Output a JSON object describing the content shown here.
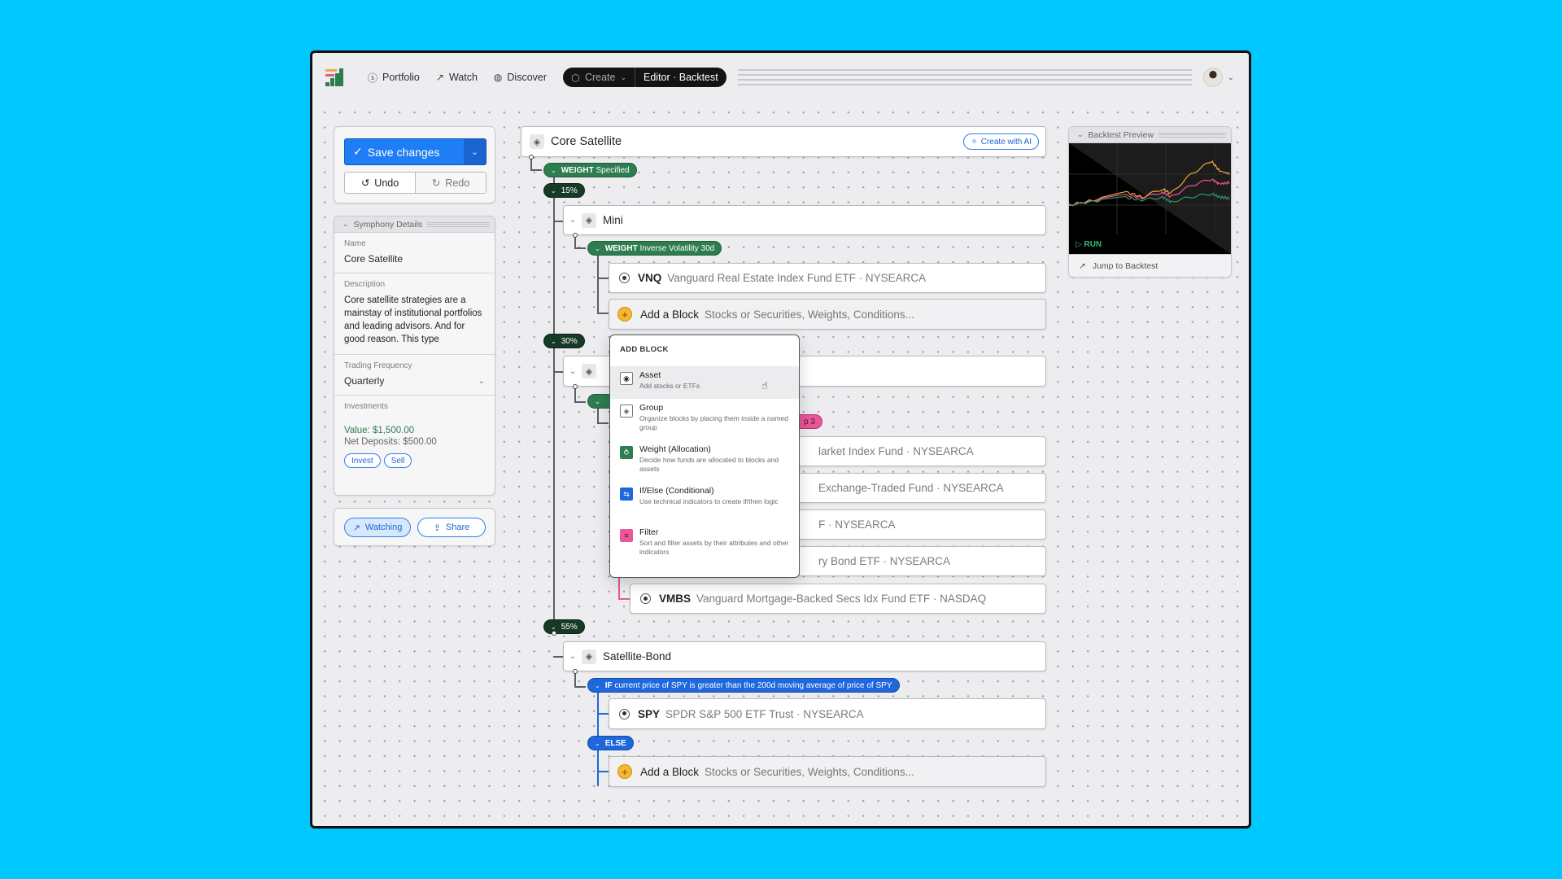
{
  "nav": {
    "logo": "composer-logo",
    "items": [
      {
        "label": "Portfolio",
        "icon": "dollar-circle-icon"
      },
      {
        "label": "Watch",
        "icon": "trend-icon"
      },
      {
        "label": "Discover",
        "icon": "globe-icon"
      }
    ],
    "create_label": "Create",
    "editor_label": "Editor · Backtest"
  },
  "toolbar": {
    "save_label": "Save changes",
    "undo_label": "Undo",
    "redo_label": "Redo"
  },
  "details": {
    "panel_title": "Symphony Details",
    "name_label": "Name",
    "name_value": "Core Satellite",
    "description_label": "Description",
    "description_value": "Core satellite strategies are a mainstay of institutional portfolios and leading advisors. And for good reason. This type",
    "frequency_label": "Trading Frequency",
    "frequency_value": "Quarterly",
    "investments_label": "Investments",
    "value_text": "Value: $1,500.00",
    "net_deposits_text": "Net Deposits: $500.00",
    "invest_label": "Invest",
    "sell_label": "Sell"
  },
  "social": {
    "watching_label": "Watching",
    "share_label": "Share"
  },
  "tree": {
    "root_name": "Core Satellite",
    "ai_button": "Create with AI",
    "root_weight": {
      "kind": "WEIGHT",
      "detail": "Specified"
    },
    "branches": [
      {
        "pct": "15%"
      },
      {
        "pct": "30%"
      },
      {
        "pct": "55%"
      }
    ],
    "mini": {
      "name": "Mini",
      "weight": {
        "kind": "WEIGHT",
        "detail": "Inverse Volatility 30d"
      },
      "asset": {
        "ticker": "VNQ",
        "name": "Vanguard Real Estate Index Fund ETF · NYSEARCA"
      }
    },
    "add_block": {
      "title": "Add a Block",
      "hint": "Stocks or Securities, Weights, Conditions..."
    },
    "group2": {
      "filter_visible": "p 3",
      "assets_visible": [
        "larket Index Fund · NYSEARCA",
        "Exchange-Traded Fund · NYSEARCA",
        "F · NYSEARCA",
        "ry Bond ETF · NYSEARCA"
      ],
      "last_asset": {
        "ticker": "VMBS",
        "name": "Vanguard Mortgage-Backed Secs Idx Fund ETF · NASDAQ"
      }
    },
    "satellite_bond": {
      "name": "Satellite-Bond",
      "if": {
        "kind": "IF",
        "detail": "current price of SPY is greater than the 200d moving average of price of SPY"
      },
      "asset": {
        "ticker": "SPY",
        "name": "SPDR S&P 500 ETF Trust · NYSEARCA"
      },
      "else_label": "ELSE"
    }
  },
  "add_menu": {
    "title": "ADD BLOCK",
    "items": [
      {
        "name": "Asset",
        "desc": "Add stocks or ETFs"
      },
      {
        "name": "Group",
        "desc": "Organize blocks by placing them inside a named group"
      },
      {
        "name": "Weight (Allocation)",
        "desc": "Decide how funds are allocated to blocks and assets"
      },
      {
        "name": "If/Else (Conditional)",
        "desc": "Use technical indicators to create if/then logic"
      },
      {
        "name": "Filter",
        "desc": "Sort and filter assets by their attributes and other indicators"
      }
    ]
  },
  "backtest": {
    "title": "Backtest Preview",
    "run_label": "RUN",
    "jump_label": "Jump to Backtest",
    "series_colors": [
      "#f0a83a",
      "#e9579a",
      "#2e9a63"
    ]
  },
  "colors": {
    "background": "#00c8ff",
    "primary": "#1f7ef5",
    "weight": "#2e7d4f",
    "percent": "#153a26",
    "condition": "#1f67dd",
    "filter": "#e9579a",
    "add": "#f5b731"
  }
}
